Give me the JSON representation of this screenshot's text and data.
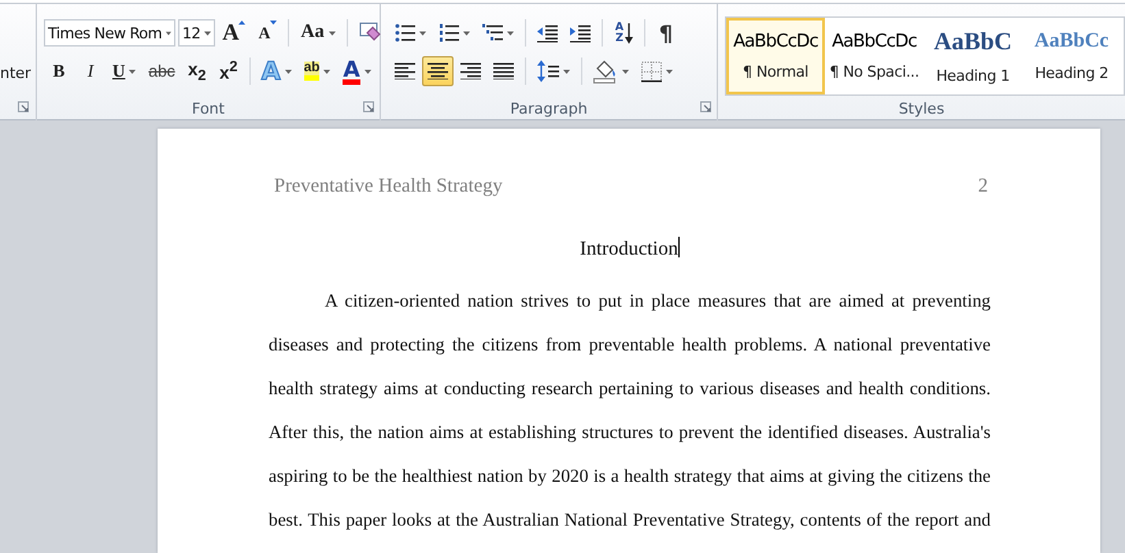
{
  "ribbon": {
    "clipboard_group": {
      "label_fragment": "nter"
    },
    "font_group": {
      "label": "Font",
      "font_name": "Times New Rom",
      "font_size": "12",
      "row1": [
        {
          "kind": "grow",
          "label": "A",
          "dropdown": false
        },
        {
          "kind": "shrink",
          "label": "A",
          "dropdown": false
        },
        {
          "kind": "sep"
        },
        {
          "kind": "case",
          "label": "Aa",
          "dropdown": true
        },
        {
          "kind": "sep"
        },
        {
          "kind": "clear",
          "dropdown": false
        }
      ],
      "row2": [
        {
          "kind": "bold",
          "label": "B",
          "dropdown": false
        },
        {
          "kind": "italic",
          "label": "I",
          "dropdown": false
        },
        {
          "kind": "underline",
          "label": "U",
          "dropdown": true
        },
        {
          "kind": "strike",
          "label": "abc",
          "dropdown": false
        },
        {
          "kind": "subscript",
          "label": "x$_{2}$",
          "dropdown": false
        },
        {
          "kind": "superscript",
          "label": "x$^{2}$",
          "dropdown": false
        },
        {
          "kind": "sep"
        },
        {
          "kind": "effects",
          "label": "A",
          "dropdown": true
        },
        {
          "kind": "highlight",
          "label": "ab",
          "dropdown": true
        },
        {
          "kind": "color",
          "label": "A",
          "dropdown": true
        }
      ]
    },
    "paragraph_group": {
      "label": "Paragraph",
      "row1": [
        {
          "kind": "bullets",
          "dropdown": true
        },
        {
          "kind": "numbering",
          "dropdown": true
        },
        {
          "kind": "multilevel",
          "dropdown": true
        },
        {
          "kind": "sep"
        },
        {
          "kind": "outdent",
          "dropdown": false
        },
        {
          "kind": "indent",
          "dropdown": false
        },
        {
          "kind": "sep"
        },
        {
          "kind": "sort",
          "label": "AZ",
          "dropdown": false
        },
        {
          "kind": "sep"
        },
        {
          "kind": "pilcrow",
          "label": "¶",
          "dropdown": false
        }
      ],
      "row2": [
        {
          "kind": "align-left",
          "dropdown": false,
          "selected": false
        },
        {
          "kind": "align-center",
          "dropdown": false,
          "selected": true
        },
        {
          "kind": "align-right",
          "dropdown": false,
          "selected": false
        },
        {
          "kind": "justify",
          "dropdown": false,
          "selected": false
        },
        {
          "kind": "sep"
        },
        {
          "kind": "spacing",
          "dropdown": true
        },
        {
          "kind": "sep"
        },
        {
          "kind": "shading",
          "dropdown": true
        },
        {
          "kind": "borders",
          "dropdown": true
        }
      ]
    },
    "styles_group": {
      "label": "Styles",
      "items": [
        {
          "preview": "AaBbCcDc",
          "name": "¶ Normal",
          "kind": "body",
          "selected": true
        },
        {
          "preview": "AaBbCcDc",
          "name": "¶ No Spaci...",
          "kind": "body",
          "selected": false
        },
        {
          "preview": "AaBbC",
          "name": "Heading 1",
          "kind": "heading1",
          "selected": false
        },
        {
          "preview": "AaBbCc",
          "name": "Heading 2",
          "kind": "heading2",
          "selected": false
        }
      ]
    }
  },
  "document": {
    "header_title": "Preventative Health Strategy",
    "page_number": "2",
    "heading": "Introduction",
    "paragraph_lines": [
      "A citizen-oriented nation strives to put in place measures that are aimed at preventing",
      "diseases and protecting the citizens from preventable health problems. A national preventative",
      "health strategy aims at conducting research pertaining to various diseases and health conditions.",
      "After this, the nation aims at establishing structures to prevent the identified diseases. Australia's",
      "aspiring to be the healthiest nation by 2020 is a health strategy that aims at giving the citizens the",
      "best. This paper looks at the Australian National Preventative Strategy, contents of the report and"
    ]
  }
}
